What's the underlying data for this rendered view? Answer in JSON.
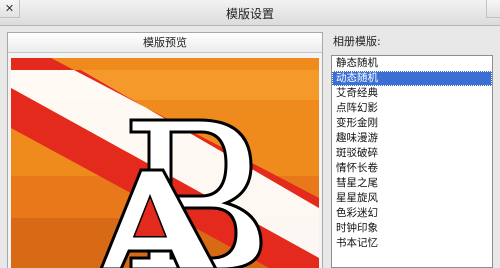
{
  "window": {
    "title": "模版设置",
    "close_glyph": "✕"
  },
  "preview": {
    "header": "模版预览",
    "image_label": "R A"
  },
  "album_list": {
    "label": "相册模版:",
    "selected_index": 1,
    "items": [
      "静态随机",
      "动态随机",
      "艾奇经典",
      "点阵幻影",
      "变形金刚",
      "趣味漫游",
      "斑驳破碎",
      "情怀长卷",
      "彗星之尾",
      "星星旋风",
      "色彩迷幻",
      "时钟印象",
      "书本记忆"
    ]
  },
  "colors": {
    "selection": "#3b6fd3",
    "stripe_orange": "#f28a1e",
    "stripe_red": "#e3201e"
  }
}
